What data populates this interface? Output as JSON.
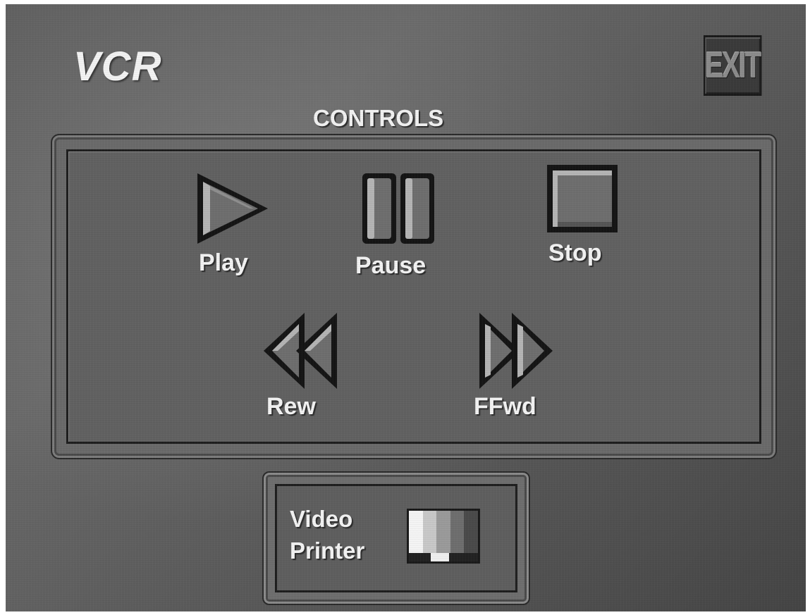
{
  "window": {
    "title": "VCR"
  },
  "exit_button": {
    "label": "EXIT"
  },
  "controls": {
    "heading": "CONTROLS",
    "buttons": [
      {
        "id": "play",
        "label": "Play",
        "icon": "play-icon"
      },
      {
        "id": "pause",
        "label": "Pause",
        "icon": "pause-icon"
      },
      {
        "id": "stop",
        "label": "Stop",
        "icon": "stop-icon"
      },
      {
        "id": "rew",
        "label": "Rew",
        "icon": "rewind-icon"
      },
      {
        "id": "ffwd",
        "label": "FFwd",
        "icon": "fast-forward-icon"
      }
    ]
  },
  "video_printer": {
    "label_line1": "Video",
    "label_line2": "Printer",
    "icon": "color-bars-icon",
    "bar_colors": [
      "#f4f4f4",
      "#c8c8c8",
      "#9a9a9a",
      "#6e6e6e",
      "#4a4a4a"
    ]
  },
  "colors": {
    "background": "#5e5e5e",
    "panel": "#626262",
    "icon_fill": "#707070",
    "icon_highlight": "#b0b0b0",
    "icon_outline": "#151515",
    "text": "#f2f2f2"
  }
}
